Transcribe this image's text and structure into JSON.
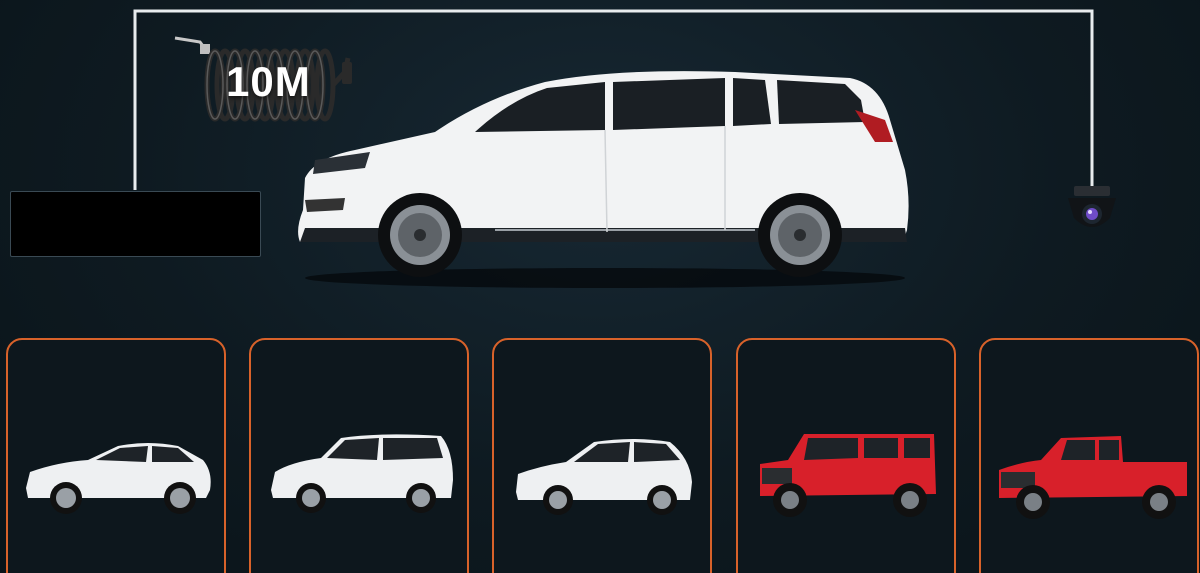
{
  "cable": {
    "length_label": "10M"
  },
  "colors": {
    "background": "#0f1a20",
    "card_border": "#d8622a",
    "wire": "#e8ecee",
    "van_body": "#f2f3f4",
    "red_vehicle": "#d8202a"
  },
  "vehicles": [
    {
      "kind": "white-suv-coupe"
    },
    {
      "kind": "white-minivan"
    },
    {
      "kind": "white-hatchback"
    },
    {
      "kind": "red-offroad-jeep"
    },
    {
      "kind": "red-pickup-truck"
    }
  ]
}
